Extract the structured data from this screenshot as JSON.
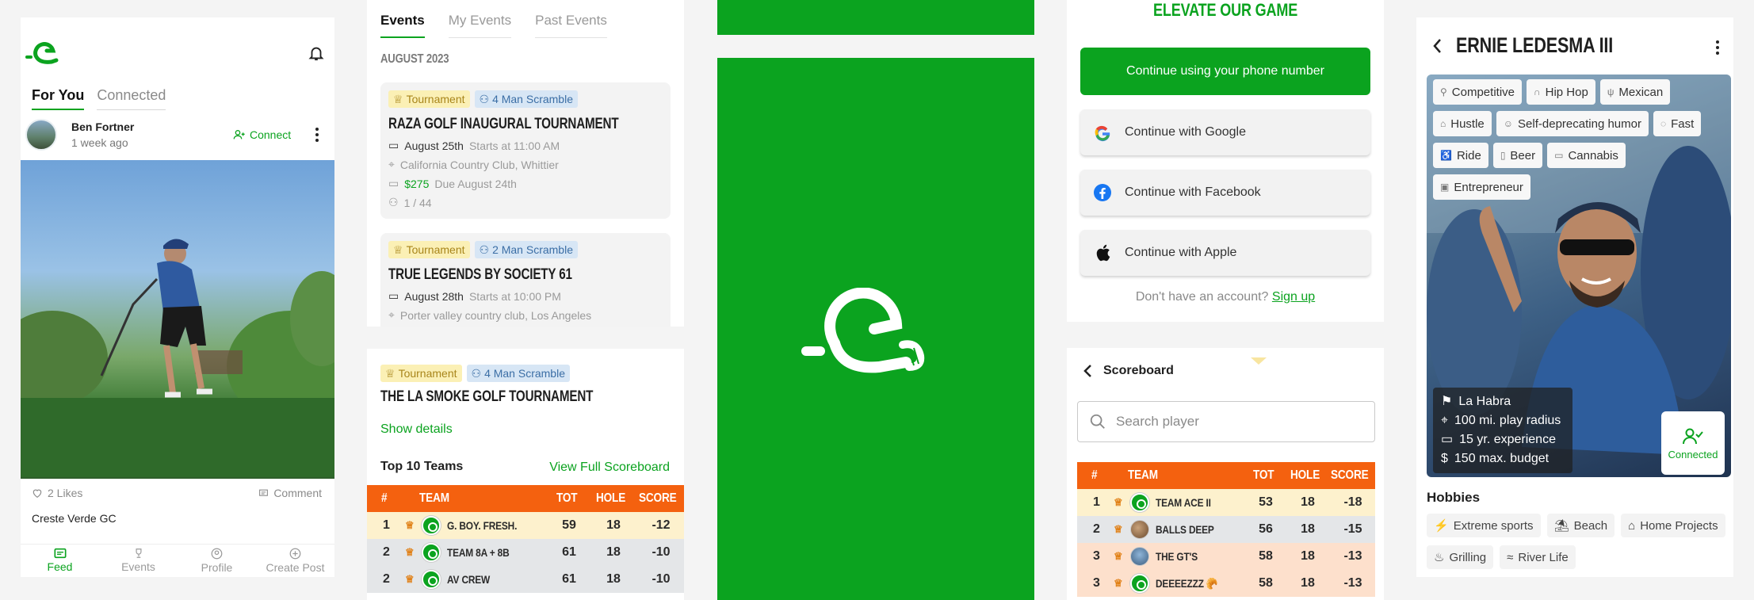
{
  "colors": {
    "brand_green": "#0ba31f",
    "scoreboard_orange": "#f4610f",
    "highlight_yellow": "#fdf1cd"
  },
  "feed": {
    "tabs": [
      "For You",
      "Connected"
    ],
    "post": {
      "author": "Ben Fortner",
      "time": "1 week ago",
      "connect_label": "Connect",
      "likes": "2 Likes",
      "comment_label": "Comment",
      "caption": "Creste Verde GC"
    },
    "nav": [
      "Feed",
      "Events",
      "Profile",
      "Create Post"
    ]
  },
  "events": {
    "tabs": [
      "Events",
      "My Events",
      "Past Events"
    ],
    "month": "AUGUST 2023",
    "cards": [
      {
        "tag1": "Tournament",
        "tag2": "4 Man Scramble",
        "title": "RAZA GOLF INAUGURAL TOURNAMENT",
        "date": "August 25th",
        "start": "Starts at 11:00 AM",
        "location": "California Country Club, Whittier",
        "price": "$275",
        "due": "Due August 24th",
        "spots": "1 / 44"
      },
      {
        "tag1": "Tournament",
        "tag2": "2 Man Scramble",
        "title": "TRUE LEGENDS BY SOCIETY 61",
        "date": "August 28th",
        "start": "Starts at 10:00 PM",
        "location": "Porter valley country club, Los Angeles"
      }
    ],
    "detail": {
      "tag1": "Tournament",
      "tag2": "4 Man Scramble",
      "title": "THE LA SMOKE GOLF TOURNAMENT",
      "show_details": "Show details",
      "top_label": "Top 10 Teams",
      "full_link": "View Full Scoreboard",
      "headers": [
        "#",
        "TEAM",
        "TOT",
        "HOLE",
        "SCORE"
      ],
      "rows": [
        {
          "rank": "1",
          "team": "G. BOY. FRESH.",
          "tot": "59",
          "hole": "18",
          "score": "-12"
        },
        {
          "rank": "2",
          "team": "TEAM 8A + 8B",
          "tot": "61",
          "hole": "18",
          "score": "-10"
        },
        {
          "rank": "2",
          "team": "AV CREW",
          "tot": "61",
          "hole": "18",
          "score": "-10"
        }
      ]
    }
  },
  "login": {
    "heading": "ELEVATE OUR GAME",
    "phone_button": "Continue using your phone number",
    "google_button": "Continue with Google",
    "facebook_button": "Continue with Facebook",
    "apple_button": "Continue with Apple",
    "no_account": "Don't have an account?",
    "sign_up": "Sign up"
  },
  "scoreboard": {
    "title": "Scoreboard",
    "search_placeholder": "Search player",
    "headers": [
      "#",
      "TEAM",
      "TOT",
      "HOLE",
      "SCORE"
    ],
    "rows": [
      {
        "rank": "1",
        "team": "TEAM ACE II",
        "tot": "53",
        "hole": "18",
        "score": "-18"
      },
      {
        "rank": "2",
        "team": "BALLS DEEP",
        "tot": "56",
        "hole": "18",
        "score": "-15"
      },
      {
        "rank": "3",
        "team": "THE GT'S",
        "tot": "58",
        "hole": "18",
        "score": "-13"
      },
      {
        "rank": "3",
        "team": "DEEEEZZZ 🥐",
        "tot": "58",
        "hole": "18",
        "score": "-13"
      }
    ]
  },
  "profile": {
    "name": "ERNIE LEDESMA III",
    "traits": [
      "Competitive",
      "Hip Hop",
      "Mexican",
      "Hustle",
      "Self-deprecating humor",
      "Fast",
      "Ride",
      "Beer",
      "Cannabis",
      "Entrepreneur"
    ],
    "info": {
      "city": "La Habra",
      "radius": "100 mi. play radius",
      "experience": "15 yr. experience",
      "budget": "150 max. budget"
    },
    "connected_label": "Connected",
    "hobbies_title": "Hobbies",
    "hobbies": [
      "Extreme sports",
      "Beach",
      "Home Projects",
      "Grilling",
      "River Life"
    ]
  }
}
